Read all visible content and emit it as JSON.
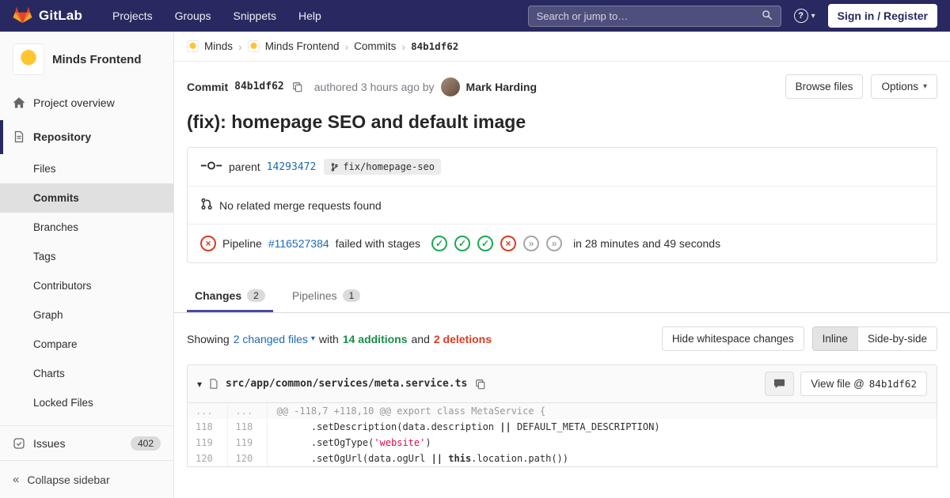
{
  "colors": {
    "navbar_bg": "#292961",
    "link_blue": "#1b69b6",
    "success_green": "#1aaa55",
    "failed_red": "#db3b21",
    "additions_green": "#168f48",
    "deletions_red": "#db3b21",
    "active_tab_indicator": "#4b4ba3",
    "sidebar_bg": "#fafafa",
    "string_token": "#d14"
  },
  "icons": {
    "caret_down": "▾",
    "breadcrumb_chevron": "›",
    "collapse_chevrons": "«",
    "check": "✓",
    "cross": "×",
    "skipped": "»",
    "question": "?"
  },
  "navbar": {
    "brand": "GitLab",
    "links": [
      "Projects",
      "Groups",
      "Snippets",
      "Help"
    ],
    "search_placeholder": "Search or jump to…",
    "sign_in_label": "Sign in / Register"
  },
  "sidebar": {
    "project_name": "Minds Frontend",
    "overview_label": "Project overview",
    "repository_label": "Repository",
    "repo_items": [
      "Files",
      "Commits",
      "Branches",
      "Tags",
      "Contributors",
      "Graph",
      "Compare",
      "Charts",
      "Locked Files"
    ],
    "active_repo_item": "Commits",
    "issues_label": "Issues",
    "issues_count": "402",
    "collapse_label": "Collapse sidebar"
  },
  "breadcrumb": {
    "minds": "Minds",
    "minds_frontend": "Minds Frontend",
    "commits": "Commits",
    "sha": "84b1df62"
  },
  "commit": {
    "label": "Commit",
    "sha": "84b1df62",
    "authored_text": "authored 3 hours ago by",
    "author_name": "Mark Harding",
    "browse_files_label": "Browse files",
    "options_label": "Options",
    "title": "(fix): homepage SEO and default image",
    "parent_label": "parent",
    "parent_sha": "14293472",
    "branch_name": "fix/homepage-seo",
    "no_mr_text": "No related merge requests found",
    "pipeline_label": "Pipeline",
    "pipeline_id": "#116527384",
    "pipeline_status_text": "failed with stages",
    "pipeline_stages": [
      "success",
      "success",
      "success",
      "failed",
      "skipped",
      "skipped"
    ],
    "pipeline_duration_text": "in 28 minutes and 49 seconds"
  },
  "tabs": {
    "changes_label": "Changes",
    "changes_count": "2",
    "pipelines_label": "Pipelines",
    "pipelines_count": "1"
  },
  "changes_bar": {
    "showing": "Showing",
    "changed_files_link": "2 changed files",
    "with_text": "with",
    "additions_text": "14 additions",
    "and_text": "and",
    "deletions_text": "2 deletions",
    "hide_whitespace_label": "Hide whitespace changes",
    "inline_label": "Inline",
    "side_by_side_label": "Side-by-side"
  },
  "diff": {
    "filename": "src/app/common/services/meta.service.ts",
    "view_file_prefix": "View file @",
    "view_file_sha": "84b1df62",
    "hunk": {
      "old_num": "...",
      "new_num": "...",
      "text": "@@ -118,7 +118,10 @@ export class MetaService {"
    },
    "line1": {
      "old_num": "118",
      "new_num": "118",
      "a": "      .setDescription(data.description ",
      "op": "||",
      "b": " DEFAULT_META_DESCRIPTION)"
    },
    "line2": {
      "old_num": "119",
      "new_num": "119",
      "a": "      .setOgType(",
      "str": "'website'",
      "b": ")"
    },
    "line3": {
      "old_num": "120",
      "new_num": "120",
      "a": "      .setOgUrl(data.ogUrl ",
      "op": "||",
      "mid": " ",
      "kw": "this",
      "b": ".location.path())"
    }
  }
}
